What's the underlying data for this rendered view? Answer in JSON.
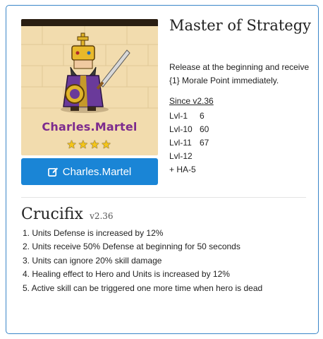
{
  "hero": {
    "image_name": "Charles.Martel",
    "stars": "★★★★",
    "button_label": "Charles.Martel"
  },
  "skill": {
    "title": "Master of Strategy",
    "description": "Release at the beginning and receive {1} Morale Point immediately.",
    "since": "Since v2.36",
    "levels": [
      {
        "name": "Lvl-1",
        "value": "6"
      },
      {
        "name": "Lvl-10",
        "value": "60"
      },
      {
        "name": "Lvl-11",
        "value": "67"
      },
      {
        "name": "Lvl-12",
        "value": ""
      },
      {
        "name": "+ HA-5",
        "value": ""
      }
    ]
  },
  "talent": {
    "name": "Crucifix",
    "version": "v2.36",
    "items": [
      "1. Units Defense is increased by 12%",
      "2. Units receive 50% Defense at beginning for 50 seconds",
      "3. Units can ignore 20% skill damage",
      "4. Healing effect to Hero and Units is increased by 12%",
      "5. Active skill can be triggered one more time when hero is dead"
    ]
  },
  "colors": {
    "border": "#3a86c8",
    "button": "#1a85d6",
    "hero_name": "#7d2b8e",
    "star": "#f5c518",
    "portrait_background": "#f2dcae"
  }
}
